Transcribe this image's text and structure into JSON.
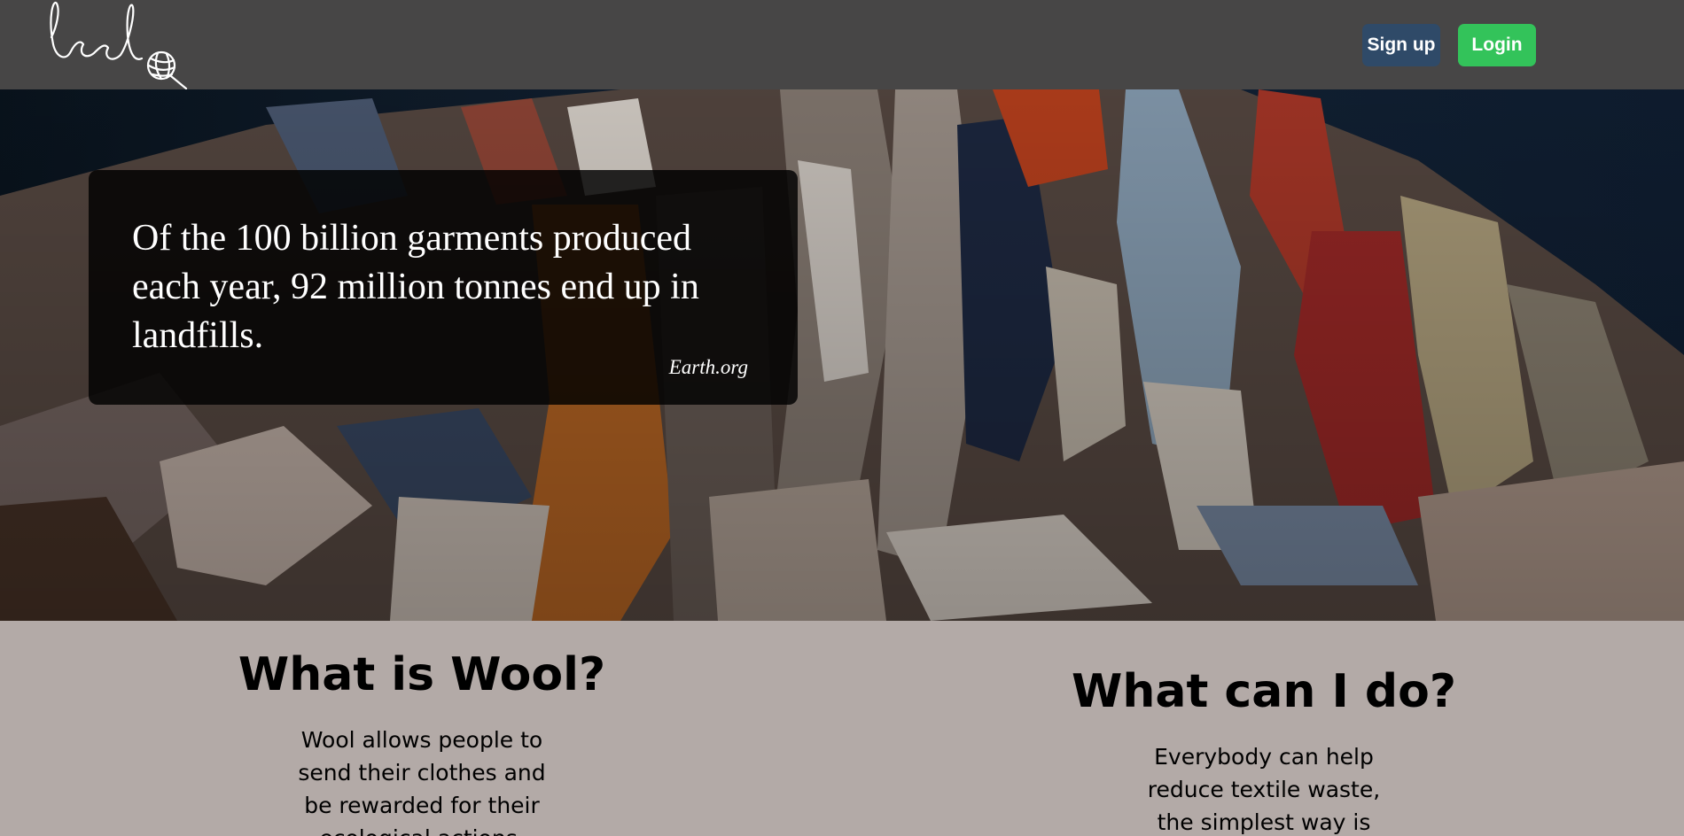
{
  "header": {
    "logo_name": "wool-logo",
    "signup_label": "Sign up",
    "login_label": "Login",
    "colors": {
      "background": "#474646",
      "signup": "#2f4a68",
      "login": "#33c35a"
    }
  },
  "hero": {
    "quote": "Of the 100 billion garments produced each year, 92 million tonnes end up in landfills.",
    "source": "Earth.org"
  },
  "info": {
    "left": {
      "title": "What is Wool?",
      "body": "Wool allows people to send their clothes and be rewarded for their ecological actions."
    },
    "right": {
      "title": "What can I do?",
      "body": "Everybody can help reduce textile waste, the simplest way is Wool."
    },
    "background": "#b3aaa7"
  }
}
